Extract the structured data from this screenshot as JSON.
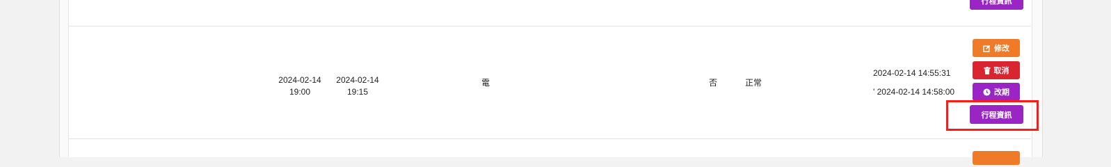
{
  "colors": {
    "edit": "#ee7a2a",
    "cancel": "#d9252f",
    "reschedule": "#9a25c4",
    "itinerary": "#9a25c4",
    "highlight": "#ff1a1a"
  },
  "prev_row": {
    "itinerary_label": "行程資訊"
  },
  "row": {
    "start_date": "2024-02-14",
    "start_time": "19:00",
    "end_date": "2024-02-14",
    "end_time": "19:15",
    "type": "電",
    "flag": "否",
    "status": "正常",
    "created_at": "2024-02-14 14:55:31",
    "updated_at": "' 2024-02-14 14:58:00",
    "actions": {
      "edit_label": "修改",
      "edit_icon": "edit-icon",
      "cancel_label": "取消",
      "cancel_icon": "trash-icon",
      "reschedule_label": "改期",
      "reschedule_icon": "clock-icon",
      "itinerary_label": "行程資訊"
    }
  }
}
